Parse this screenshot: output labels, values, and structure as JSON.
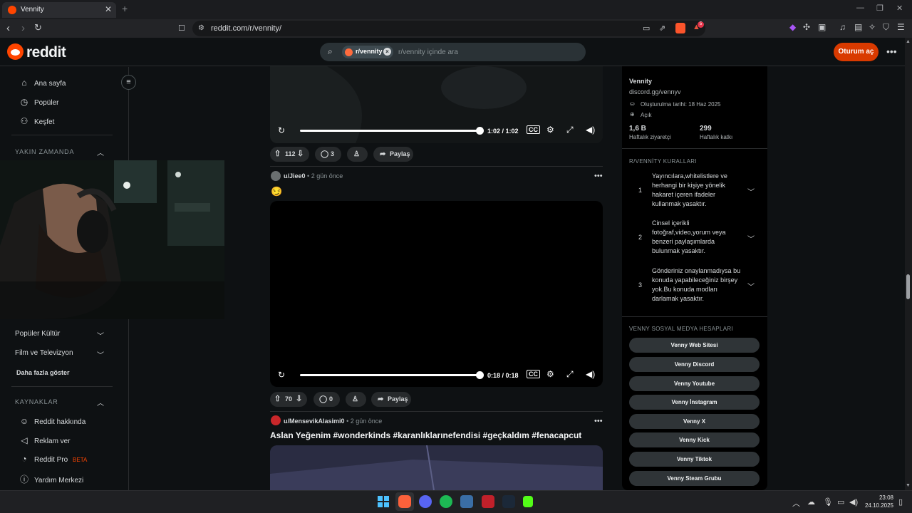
{
  "browser": {
    "tab_title": "Vennity",
    "new_tab": "+",
    "url": "reddit.com/r/vennity/",
    "badge_count": "5"
  },
  "header": {
    "logo": "reddit",
    "search_chip": "r/vennity",
    "search_placeholder": "r/vennity içinde ara",
    "login": "Oturum aç"
  },
  "sidebar": {
    "main": [
      {
        "label": "Ana sayfa",
        "icon": "home-icon"
      },
      {
        "label": "Popüler",
        "icon": "popular-icon"
      },
      {
        "label": "Keşfet",
        "icon": "explore-icon"
      }
    ],
    "recent_header": "YAKIN ZAMANDA",
    "topics": [
      {
        "label": "Popüler Kültür"
      },
      {
        "label": "Film ve Televizyon"
      }
    ],
    "show_more": "Daha fazla göster",
    "resources_header": "KAYNAKLAR",
    "resources": [
      {
        "label": "Reddit hakkında",
        "icon": "reddit-icon"
      },
      {
        "label": "Reklam ver",
        "icon": "megaphone-icon"
      },
      {
        "label": "Reddit Pro",
        "icon": "pro-icon",
        "badge": "BETA"
      },
      {
        "label": "Yardım Merkezi",
        "icon": "help-icon"
      }
    ]
  },
  "posts": [
    {
      "time": "1:02 / 1:02",
      "votes": "112",
      "comments": "3",
      "share": "Paylaş"
    },
    {
      "author": "u/Jiee0",
      "ago": "2 gün önce",
      "emoji": "😏",
      "time": "0:18 / 0:18",
      "votes": "70",
      "comments": "0",
      "share": "Paylaş"
    },
    {
      "author": "u/MensevikAlasimi0",
      "ago": "2 gün önce",
      "title": "Aslan Yeğenim #wonderkinds #karanlıklarınefendisi #geçkaldım #fenacapcut"
    }
  ],
  "community": {
    "name": "Vennity",
    "link": "discord.gg/vennyv",
    "created": "Oluşturulma tarihi: 18 Haz 2025",
    "visibility": "Açık",
    "visitors_value": "1,6 B",
    "visitors_label": "Haftalık ziyaretçi",
    "contrib_value": "299",
    "contrib_label": "Haftalık katkı",
    "rules_header": "R/VENNİTY KURALLARI",
    "rules": [
      {
        "num": "1",
        "text": "Yayıncılara,whitelistlere ve herhangi bir kişiye yönelik hakaret içeren ifadeler kullanmak yasaktır."
      },
      {
        "num": "2",
        "text": "Cinsel içerikli fotoğraf,video,yorum veya benzeri paylaşımlarda bulunmak yasaktır."
      },
      {
        "num": "3",
        "text": "Gönderiniz onaylanmadıysa bu konuda yapabileceğiniz birşey yok.Bu konuda modları darlamak yasaktır."
      }
    ],
    "social_header": "VENNY SOSYAL MEDYA HESAPLARI",
    "social": [
      "Venny Web Sitesi",
      "Venny Discord",
      "Venny Youtube",
      "Venny İnstagram",
      "Venny X",
      "Venny Kick",
      "Venny Tiktok",
      "Venny Steam Grubu"
    ]
  },
  "taskbar": {
    "time": "23:08",
    "date": "24.10.2025"
  },
  "colors": {
    "accent": "#ff4500",
    "login_bg": "#d93a00",
    "bg": "#0e1113"
  }
}
